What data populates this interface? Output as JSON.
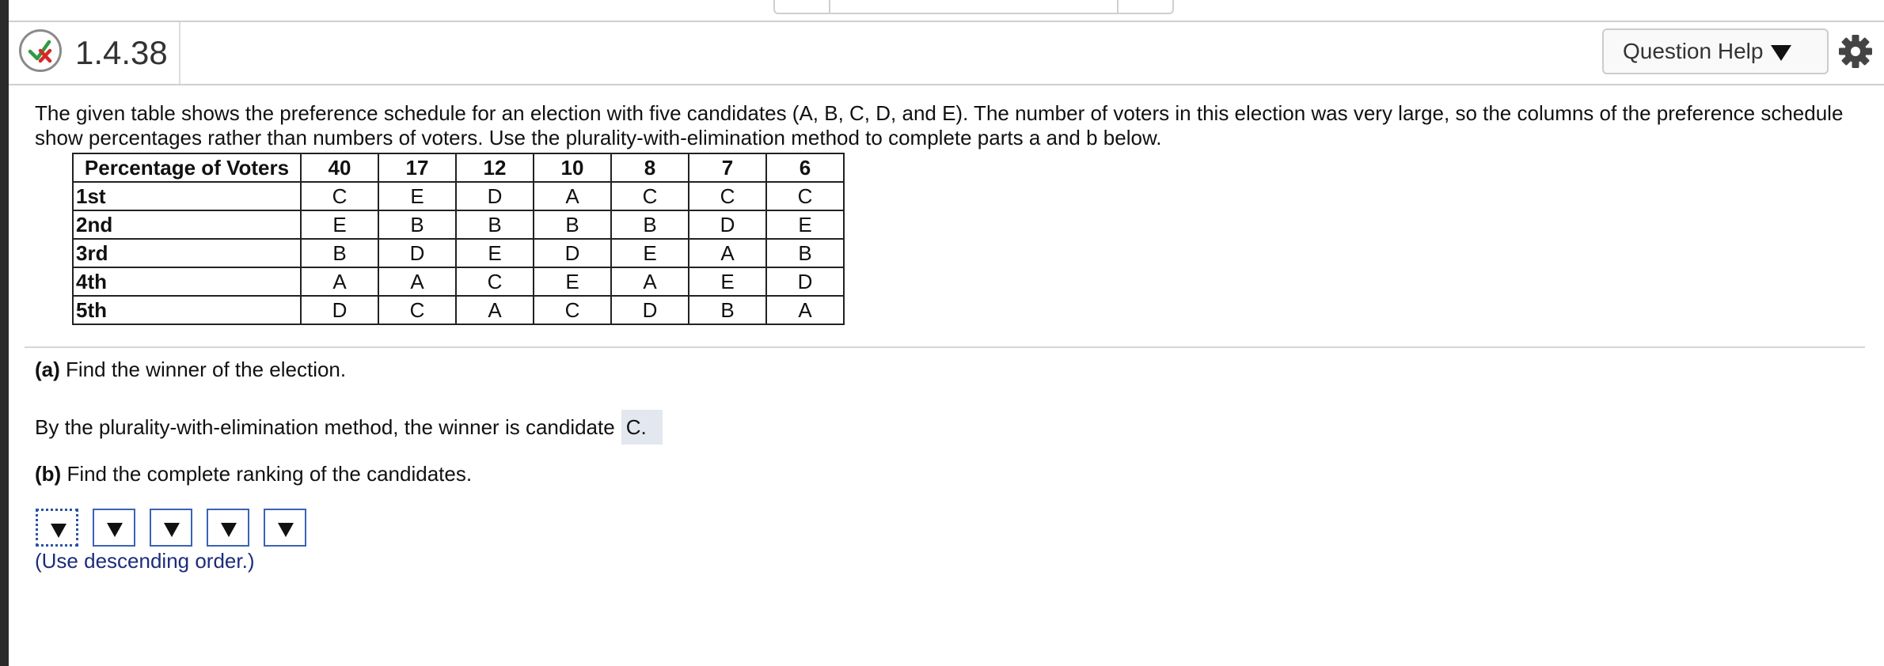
{
  "header": {
    "question_number": "1.4.38",
    "help_label": "Question Help"
  },
  "intro_text": "The given table shows the preference schedule for an election with five candidates (A, B, C, D, and E). The number of voters in this election was very large, so the columns of the preference schedule show percentages rather than numbers of voters. Use the plurality-with-elimination method to complete parts a and b below.",
  "table": {
    "header_label": "Percentage of Voters",
    "percentages": [
      "40",
      "17",
      "12",
      "10",
      "8",
      "7",
      "6"
    ],
    "rows": [
      {
        "rank": "1st",
        "cells": [
          "C",
          "E",
          "D",
          "A",
          "C",
          "C",
          "C"
        ]
      },
      {
        "rank": "2nd",
        "cells": [
          "E",
          "B",
          "B",
          "B",
          "B",
          "D",
          "E"
        ]
      },
      {
        "rank": "3rd",
        "cells": [
          "B",
          "D",
          "E",
          "D",
          "E",
          "A",
          "B"
        ]
      },
      {
        "rank": "4th",
        "cells": [
          "A",
          "A",
          "C",
          "E",
          "A",
          "E",
          "D"
        ]
      },
      {
        "rank": "5th",
        "cells": [
          "D",
          "C",
          "A",
          "C",
          "D",
          "B",
          "A"
        ]
      }
    ]
  },
  "part_a": {
    "label": "(a)",
    "question": "Find the winner of the election.",
    "answer_prefix": "By the plurality-with-elimination method, the winner is candidate",
    "answer_value": "C."
  },
  "part_b": {
    "label": "(b)",
    "question": "Find the complete ranking of the candidates.",
    "dropdown_count": 5,
    "hint": "(Use descending order.)"
  }
}
